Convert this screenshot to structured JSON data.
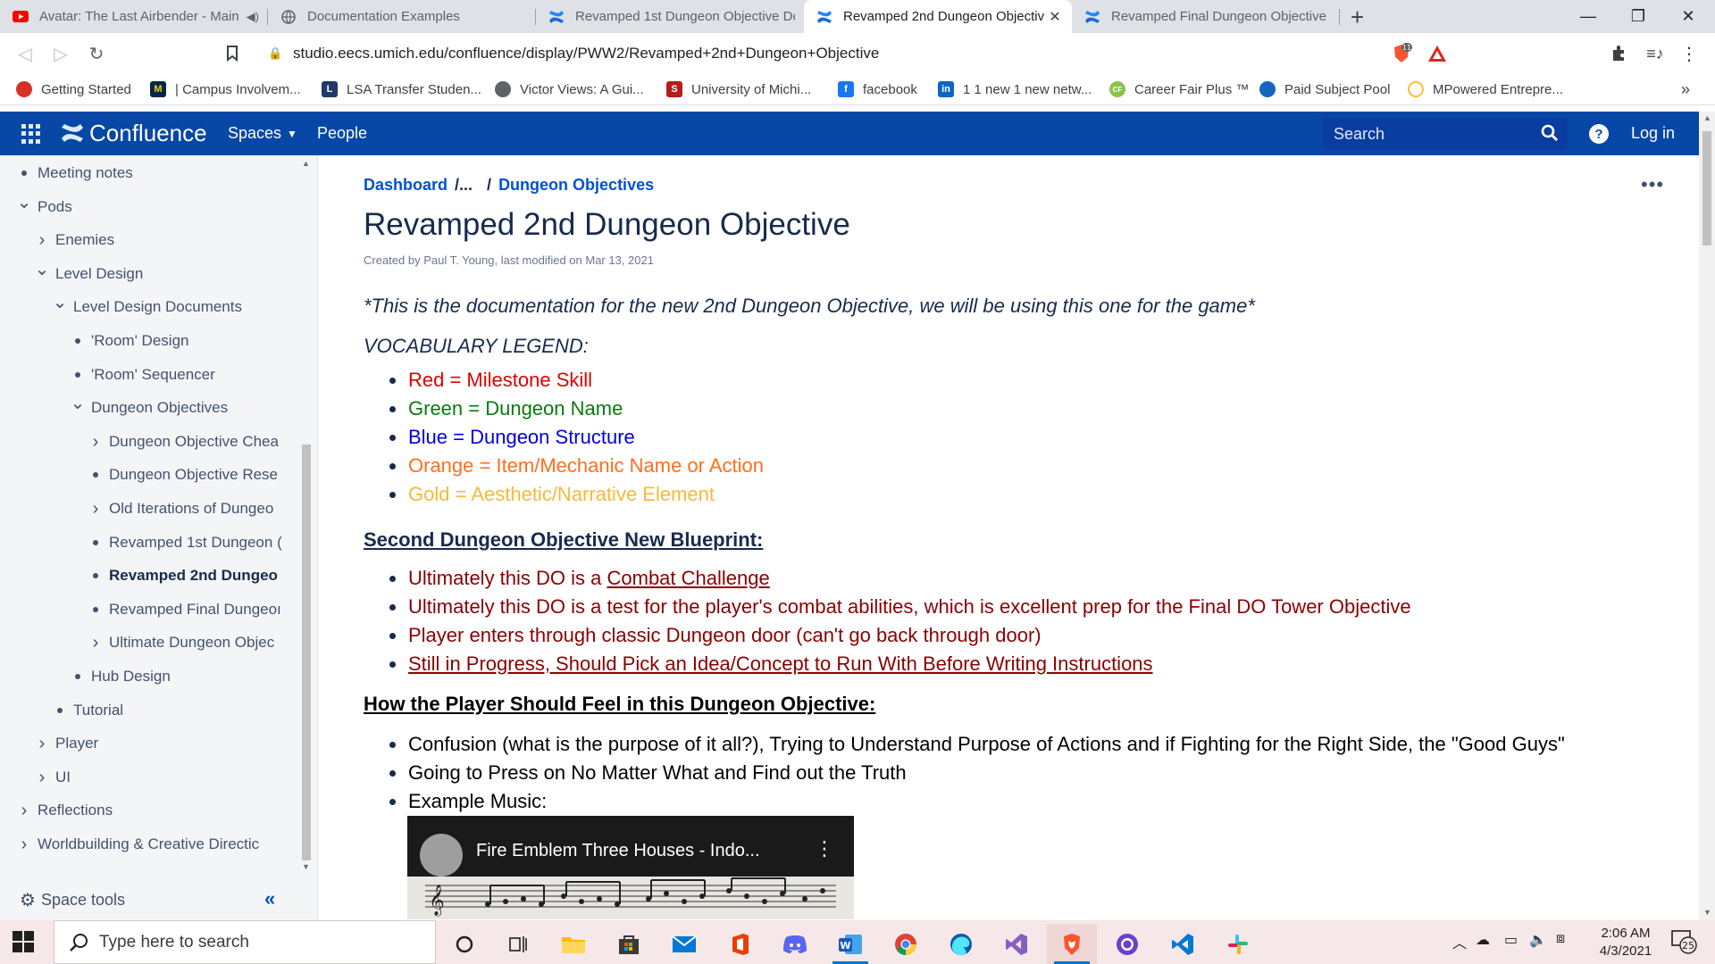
{
  "browser": {
    "tabs": [
      {
        "title": "Avatar: The Last Airbender - Main",
        "icon": "youtube-icon",
        "active": false
      },
      {
        "title": "Documentation Examples",
        "icon": "globe-icon",
        "active": false
      },
      {
        "title": "Revamped 1st Dungeon Objective De",
        "icon": "confluence-icon",
        "active": false
      },
      {
        "title": "Revamped 2nd Dungeon Objectiv",
        "icon": "confluence-icon",
        "active": true
      },
      {
        "title": "Revamped Final Dungeon Objective It",
        "icon": "confluence-icon",
        "active": false
      }
    ],
    "new_tab": "+",
    "url": "studio.eecs.umich.edu/confluence/display/PWW2/Revamped+2nd+Dungeon+Objective",
    "brave_badge": "11",
    "bookmarks": [
      {
        "label": "Getting Started",
        "color": "#d93025",
        "glyph": ""
      },
      {
        "label": "| Campus Involvem...",
        "color": "#00274c",
        "glyph": "M"
      },
      {
        "label": "LSA Transfer Studen...",
        "color": "#1f3a68",
        "glyph": "L"
      },
      {
        "label": "Victor Views: A Gui...",
        "color": "#5f6368",
        "glyph": ""
      },
      {
        "label": "University of Michi...",
        "color": "#b71c1c",
        "glyph": "S"
      },
      {
        "label": "facebook",
        "color": "#1877f2",
        "glyph": "f"
      },
      {
        "label": "1 1 new 1 new netw...",
        "color": "#0a66c2",
        "glyph": "in"
      },
      {
        "label": "Career Fair Plus ™",
        "color": "#8bc34a",
        "glyph": "CF"
      },
      {
        "label": "Paid Subject Pool",
        "color": "#1565c0",
        "glyph": ""
      },
      {
        "label": "MPowered Entrepre...",
        "color": "#fbc02d",
        "glyph": ""
      }
    ],
    "bookmarks_overflow": "»"
  },
  "confluence": {
    "brand": "Confluence",
    "nav": {
      "spaces": "Spaces",
      "people": "People"
    },
    "search_placeholder": "Search",
    "login": "Log in",
    "accent": "#0747a6"
  },
  "sidebar": {
    "items": [
      {
        "label": "Meeting notes",
        "level": 0,
        "type": "bullet"
      },
      {
        "label": "Pods",
        "level": 0,
        "type": "expanded"
      },
      {
        "label": "Enemies",
        "level": 1,
        "type": "collapsed"
      },
      {
        "label": "Level Design",
        "level": 1,
        "type": "expanded"
      },
      {
        "label": "Level Design Documents",
        "level": 2,
        "type": "expanded"
      },
      {
        "label": "'Room' Design",
        "level": 3,
        "type": "bullet"
      },
      {
        "label": "'Room' Sequencer",
        "level": 3,
        "type": "bullet"
      },
      {
        "label": "Dungeon Objectives",
        "level": 3,
        "type": "expanded"
      },
      {
        "label": "Dungeon Objective Chea",
        "level": 4,
        "type": "collapsed"
      },
      {
        "label": "Dungeon Objective Rese",
        "level": 4,
        "type": "bullet"
      },
      {
        "label": "Old Iterations of Dungeo",
        "level": 4,
        "type": "collapsed"
      },
      {
        "label": "Revamped 1st Dungeon (",
        "level": 4,
        "type": "bullet"
      },
      {
        "label": "Revamped 2nd Dungeo",
        "level": 4,
        "type": "bullet",
        "current": true
      },
      {
        "label": "Revamped Final Dungeoı",
        "level": 4,
        "type": "bullet"
      },
      {
        "label": "Ultimate Dungeon Objec",
        "level": 4,
        "type": "collapsed"
      },
      {
        "label": "Hub Design",
        "level": 3,
        "type": "bullet"
      },
      {
        "label": "Tutorial",
        "level": 2,
        "type": "bullet"
      },
      {
        "label": "Player",
        "level": 1,
        "type": "collapsed"
      },
      {
        "label": "UI",
        "level": 1,
        "type": "collapsed"
      },
      {
        "label": "Reflections",
        "level": 0,
        "type": "collapsed"
      },
      {
        "label": "Worldbuilding & Creative Directic",
        "level": 0,
        "type": "collapsed"
      }
    ],
    "space_tools": "Space tools",
    "collapse": "«"
  },
  "page": {
    "breadcrumb": {
      "dashboard": "Dashboard",
      "ellipsis": "/...",
      "slash": "/",
      "parent": "Dungeon Objectives"
    },
    "more": "•••",
    "title": "Revamped 2nd Dungeon Objective",
    "byline": "Created by Paul T. Young, last modified on Mar 13, 2021",
    "intro": "*This is the documentation for the new 2nd Dungeon Objective, we will be using this one for the game*",
    "vocab_heading": "VOCABULARY LEGEND:",
    "legend": [
      {
        "text": "Red = Milestone Skill",
        "cls": "red"
      },
      {
        "text": "Green = Dungeon Name",
        "cls": "green"
      },
      {
        "text": "Blue = Dungeon Structure",
        "cls": "blue"
      },
      {
        "text": "Orange = Item/Mechanic Name or Action",
        "cls": "orange"
      },
      {
        "text": "Gold = Aesthetic/Narrative Element",
        "cls": "gold"
      }
    ],
    "blueprint_heading": "Second Dungeon Objective New Blueprint:",
    "blueprint": {
      "b1_prefix": "Ultimately this DO is a ",
      "b1_link": "Combat Challenge",
      "b2": "Ultimately this DO is a test for the player's combat abilities, which is excellent prep for the Final DO Tower Objective",
      "b3": "Player enters through classic Dungeon door (can't go back through door)",
      "b4": "Still in Progress, Should Pick an Idea/Concept to Run With Before Writing Instructions"
    },
    "feel_heading": "How the Player Should Feel in this Dungeon Objective:",
    "feel": [
      "Confusion (what is the purpose of it all?), Trying to Understand Purpose of Actions and if Fighting for the Right Side, the \"Good Guys\"",
      "Going to Press on No Matter What and Find out the Truth",
      "Example Music:"
    ],
    "video_title": "Fire Emblem Three Houses - Indo..."
  },
  "taskbar": {
    "search_placeholder": "Type here to search",
    "time": "2:06 AM",
    "date": "4/3/2021",
    "notifications": "25"
  },
  "colors": {
    "red": "#de0000",
    "green": "#097b0e",
    "blue": "#0000de",
    "orange": "#ff6f1a",
    "gold": "#f6b93b",
    "maroon": "#8b0000"
  }
}
